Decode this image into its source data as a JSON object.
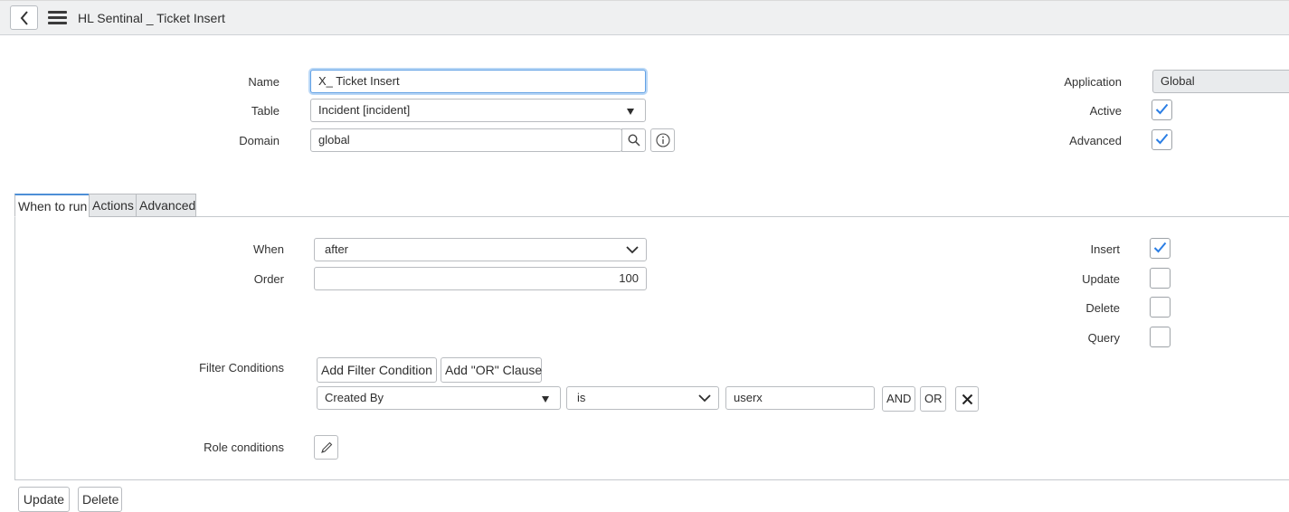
{
  "header": {
    "title": "HL Sentinal _ Ticket Insert"
  },
  "form": {
    "name_label": "Name",
    "name_value": "X_ Ticket Insert",
    "table_label": "Table",
    "table_value": "Incident [incident]",
    "domain_label": "Domain",
    "domain_value": "global",
    "application_label": "Application",
    "application_value": "Global",
    "active_label": "Active",
    "active_checked": true,
    "advanced_label": "Advanced",
    "advanced_checked": true
  },
  "tabs": [
    {
      "label": "When to run",
      "active": true
    },
    {
      "label": "Actions",
      "active": false
    },
    {
      "label": "Advanced",
      "active": false
    }
  ],
  "when_to_run": {
    "when_label": "When",
    "when_value": "after",
    "order_label": "Order",
    "order_value": "100",
    "insert_label": "Insert",
    "insert_checked": true,
    "update_label": "Update",
    "update_checked": false,
    "delete_label": "Delete",
    "delete_checked": false,
    "query_label": "Query",
    "query_checked": false,
    "filter_label": "Filter Conditions",
    "add_filter_label": "Add Filter Condition",
    "add_or_label": "Add \"OR\" Clause",
    "condition": {
      "field": "Created By",
      "operator": "is",
      "value": "userx",
      "and_label": "AND",
      "or_label": "OR"
    },
    "role_label": "Role conditions"
  },
  "footer": {
    "update_label": "Update",
    "delete_label": "Delete"
  },
  "colors": {
    "accent": "#2a7ee5",
    "header_bg": "#eff0f1"
  }
}
